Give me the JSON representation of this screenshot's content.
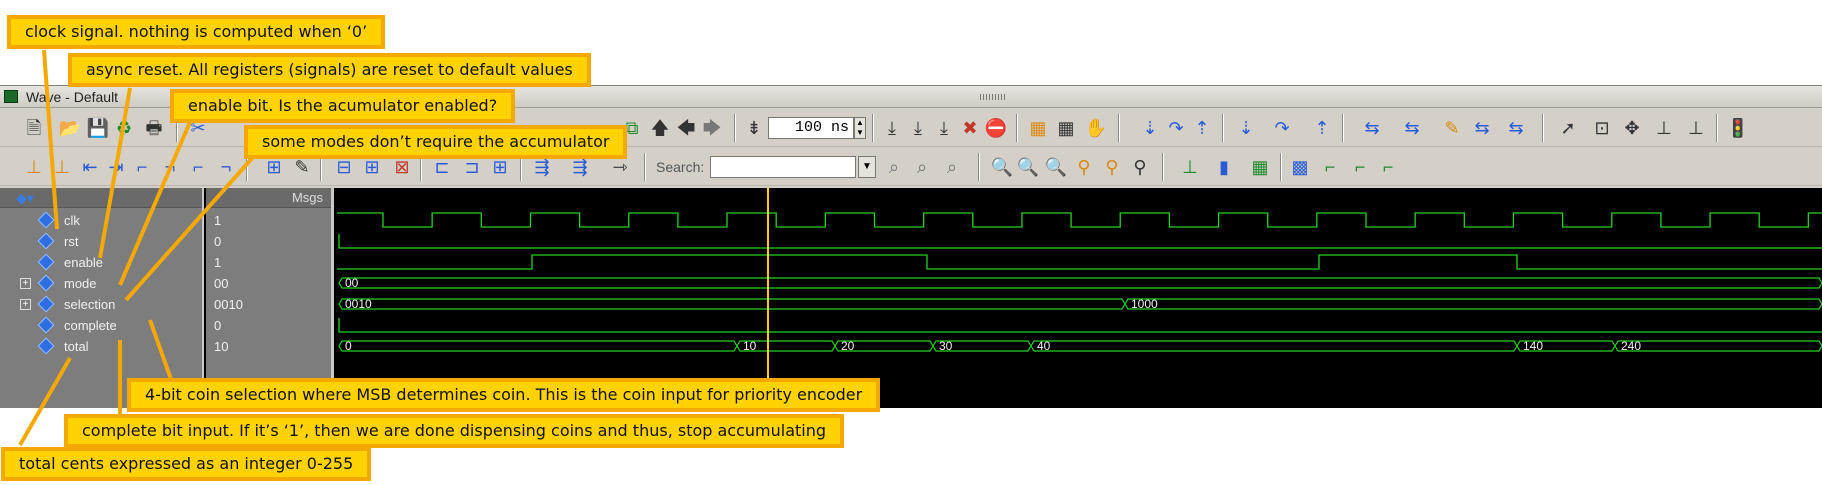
{
  "window": {
    "title": "Wave - Default"
  },
  "toolbar": {
    "time_value": "100 ns",
    "search_label": "Search:",
    "search_placeholder": ""
  },
  "panes": {
    "msgs_header": "Msgs"
  },
  "signals": [
    {
      "name": "clk",
      "value": "1",
      "expandable": false
    },
    {
      "name": "rst",
      "value": "0",
      "expandable": false
    },
    {
      "name": "enable",
      "value": "1",
      "expandable": false
    },
    {
      "name": "mode",
      "value": "00",
      "expandable": true
    },
    {
      "name": "selection",
      "value": "0010",
      "expandable": true
    },
    {
      "name": "complete",
      "value": "0",
      "expandable": false
    },
    {
      "name": "total",
      "value": "10",
      "expandable": false
    }
  ],
  "waveform": {
    "cursor_color": "#ffd200",
    "trace_color": "#22d422",
    "mode_labels": [
      "00"
    ],
    "selection_labels": [
      "0010",
      "1000"
    ],
    "total_labels": [
      "0",
      "10",
      "20",
      "30",
      "40",
      "140",
      "240"
    ]
  },
  "annotations": {
    "clock": "clock signal. nothing is computed when ‘0’",
    "reset": "async reset. All registers (signals) are reset to default values",
    "enable": "enable bit. Is the acumulator enabled?",
    "modes": "some modes don’t require the accumulator",
    "selection": "4-bit coin selection where MSB determines coin. This is the coin input for priority encoder",
    "complete": "complete bit input.  If it’s ‘1’, then we are done dispensing coins and thus, stop accumulating",
    "total": "total cents expressed as an integer 0-255"
  },
  "colors": {
    "annotation_fill": "#ffd200",
    "annotation_border": "#f5a800",
    "wave_bg": "#000000",
    "pane_bg": "#7d7d7d"
  }
}
